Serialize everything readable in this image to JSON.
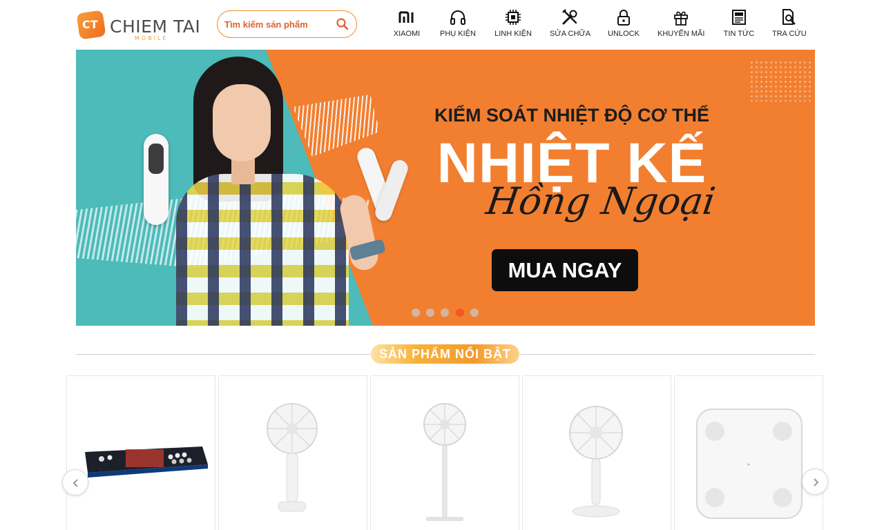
{
  "header": {
    "logo": {
      "mark": "CT",
      "name": "CHIEM TAI",
      "sub": "MOBILE"
    },
    "search": {
      "placeholder": "Tìm kiếm sản phẩm",
      "icon": "search-icon"
    },
    "nav": [
      {
        "label": "XIAOMI",
        "icon": "xiaomi-logo-icon"
      },
      {
        "label": "PHỤ KIỆN",
        "icon": "headphones-icon"
      },
      {
        "label": "LINH KIỆN",
        "icon": "chip-icon"
      },
      {
        "label": "SỬA CHỮA",
        "icon": "tools-icon"
      },
      {
        "label": "UNLOCK",
        "icon": "lock-icon"
      },
      {
        "label": "KHUYẾN MÃI",
        "icon": "gift-icon"
      },
      {
        "label": "TIN TỨC",
        "icon": "newspaper-icon"
      },
      {
        "label": "TRA CỨU",
        "icon": "document-search-icon"
      }
    ]
  },
  "banner": {
    "line1": "KIỂM SOÁT NHIỆT ĐỘ CƠ THỂ",
    "line2": "NHIỆT KẾ",
    "line3": "Hồng Ngoại",
    "cta": "MUA NGAY",
    "slide_count": 5,
    "active_slide": 4,
    "colors": {
      "orange": "#f27f30",
      "teal": "#4cbbb9",
      "cta_bg": "#0d0d0d"
    }
  },
  "section": {
    "title": "SẢN PHẨM NỔI BẬT"
  },
  "products": [
    {
      "image": "arcade-console-image"
    },
    {
      "image": "handheld-fan-image"
    },
    {
      "image": "standing-fan-image"
    },
    {
      "image": "desk-fan-image"
    },
    {
      "image": "smart-scale-image"
    }
  ],
  "carousel": {
    "prev_icon": "chevron-left-icon",
    "next_icon": "chevron-right-icon"
  },
  "colors": {
    "accent": "#f08a2c",
    "search_text": "#e0612a",
    "dot_active": "#ee5a22"
  }
}
